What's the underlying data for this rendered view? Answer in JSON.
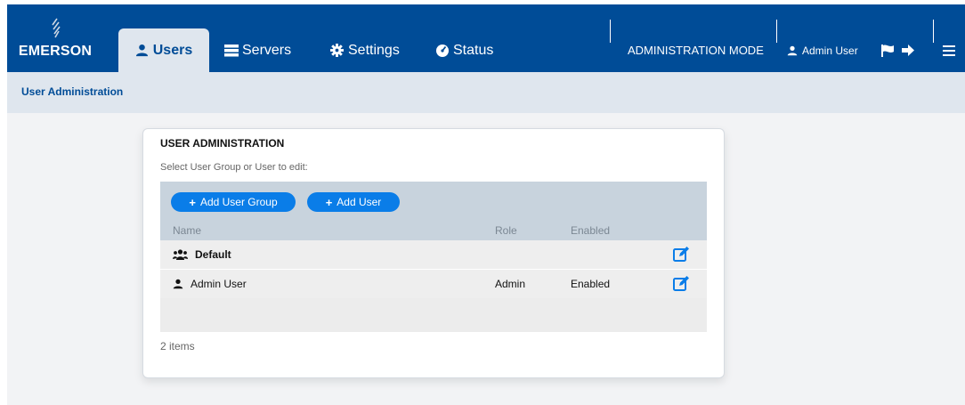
{
  "brand": {
    "name": "EMERSON"
  },
  "nav": {
    "tabs": [
      {
        "label": "Users",
        "icon": "user-icon",
        "active": true
      },
      {
        "label": "Servers",
        "icon": "servers-icon",
        "active": false
      },
      {
        "label": "Settings",
        "icon": "gear-icon",
        "active": false
      },
      {
        "label": "Status",
        "icon": "dashboard-icon",
        "active": false
      }
    ],
    "mode": "ADMINISTRATION MODE",
    "user": "Admin User"
  },
  "subheader": {
    "title": "User Administration"
  },
  "card": {
    "title": "USER ADMINISTRATION",
    "hint": "Select User Group or User to edit:",
    "add_group_label": "Add User Group",
    "add_user_label": "Add User",
    "columns": {
      "name": "Name",
      "role": "Role",
      "enabled": "Enabled"
    },
    "rows": [
      {
        "name": "Default",
        "type": "group",
        "role": "",
        "enabled": ""
      },
      {
        "name": "Admin User",
        "type": "user",
        "role": "Admin",
        "enabled": "Enabled"
      }
    ],
    "item_count": "2 items"
  },
  "colors": {
    "brand_blue": "#004c97",
    "accent_blue": "#0a7de8",
    "subbar": "#dfe6ee",
    "grid_header": "#c8d3dd"
  }
}
